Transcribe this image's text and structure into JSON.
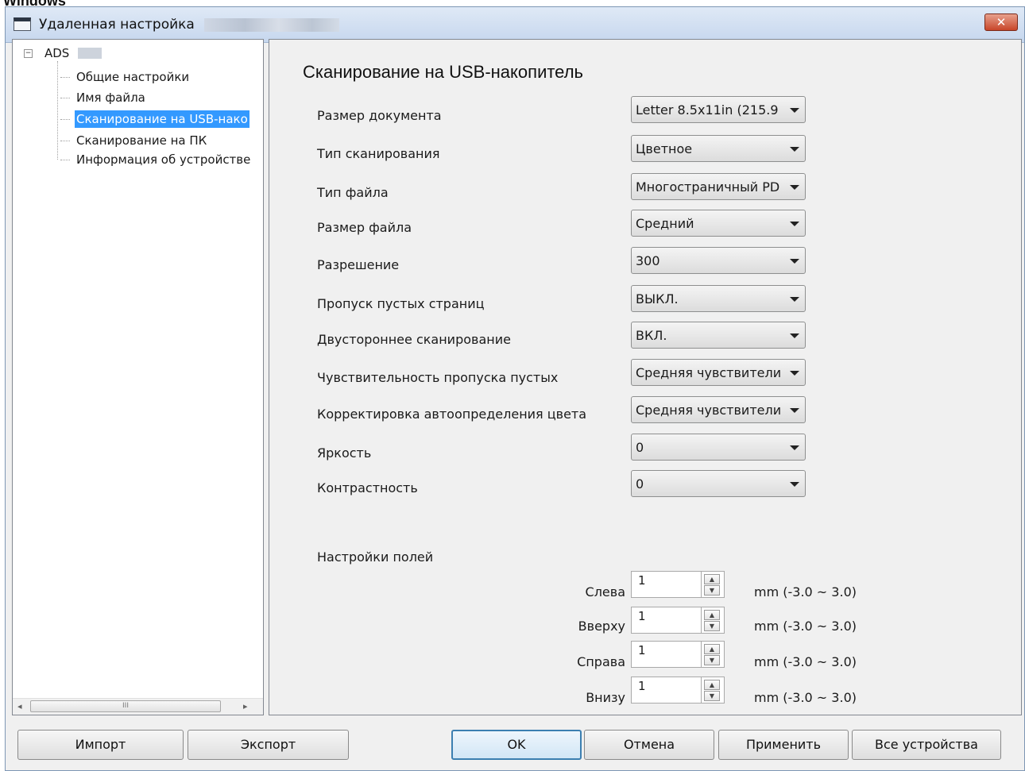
{
  "top_label": "Windows",
  "window": {
    "title": "Удаленная настройка",
    "close_label": "✕"
  },
  "tree": {
    "root_label": "ADS",
    "toggle": "−",
    "items": [
      {
        "label": "Общие настройки"
      },
      {
        "label": "Имя файла"
      },
      {
        "label": "Сканирование на USB-нако",
        "selected": true
      },
      {
        "label": "Сканирование на ПК"
      },
      {
        "label": "Информация об устройстве"
      }
    ],
    "scroll_left": "◂",
    "scroll_right": "▸",
    "scroll_grip": "III"
  },
  "main": {
    "heading": "Сканирование на USB-накопитель",
    "settings": [
      {
        "label": "Размер документа",
        "value": "Letter 8.5x11in (215.9"
      },
      {
        "label": "Тип сканирования",
        "value": "Цветное"
      },
      {
        "label": "Тип файла",
        "value": "Многостраничный PD"
      },
      {
        "label": "Размер файла",
        "value": "Средний"
      },
      {
        "label": "Разрешение",
        "value": "300"
      },
      {
        "label": "Пропуск пустых страниц",
        "value": "ВЫКЛ."
      },
      {
        "label": "Двустороннее сканирование",
        "value": "ВКЛ."
      },
      {
        "label": "Чувствительность пропуска пустых",
        "value": "Средняя чувствители"
      },
      {
        "label": "Корректировка автоопределения цвета",
        "value": "Средняя чувствители"
      },
      {
        "label": "Яркость",
        "value": "0"
      },
      {
        "label": "Контрастность",
        "value": "0"
      }
    ],
    "margins_title": "Настройки полей",
    "margins": [
      {
        "label": "Слева",
        "value": "1",
        "range": "mm (-3.0 ~ 3.0)"
      },
      {
        "label": "Вверху",
        "value": "1",
        "range": "mm (-3.0 ~ 3.0)"
      },
      {
        "label": "Справа",
        "value": "1",
        "range": "mm (-3.0 ~ 3.0)"
      },
      {
        "label": "Внизу",
        "value": "1",
        "range": "mm (-3.0 ~ 3.0)"
      }
    ],
    "spin_up": "▲",
    "spin_down": "▼"
  },
  "buttons": {
    "import": "Импорт",
    "export": "Экспорт",
    "ok": "OK",
    "cancel": "Отмена",
    "apply": "Применить",
    "all_devices": "Все устройства"
  },
  "colors": {
    "selection": "#3399ff",
    "window_bg": "#f0f0f0",
    "close_button": "#c8462a"
  }
}
